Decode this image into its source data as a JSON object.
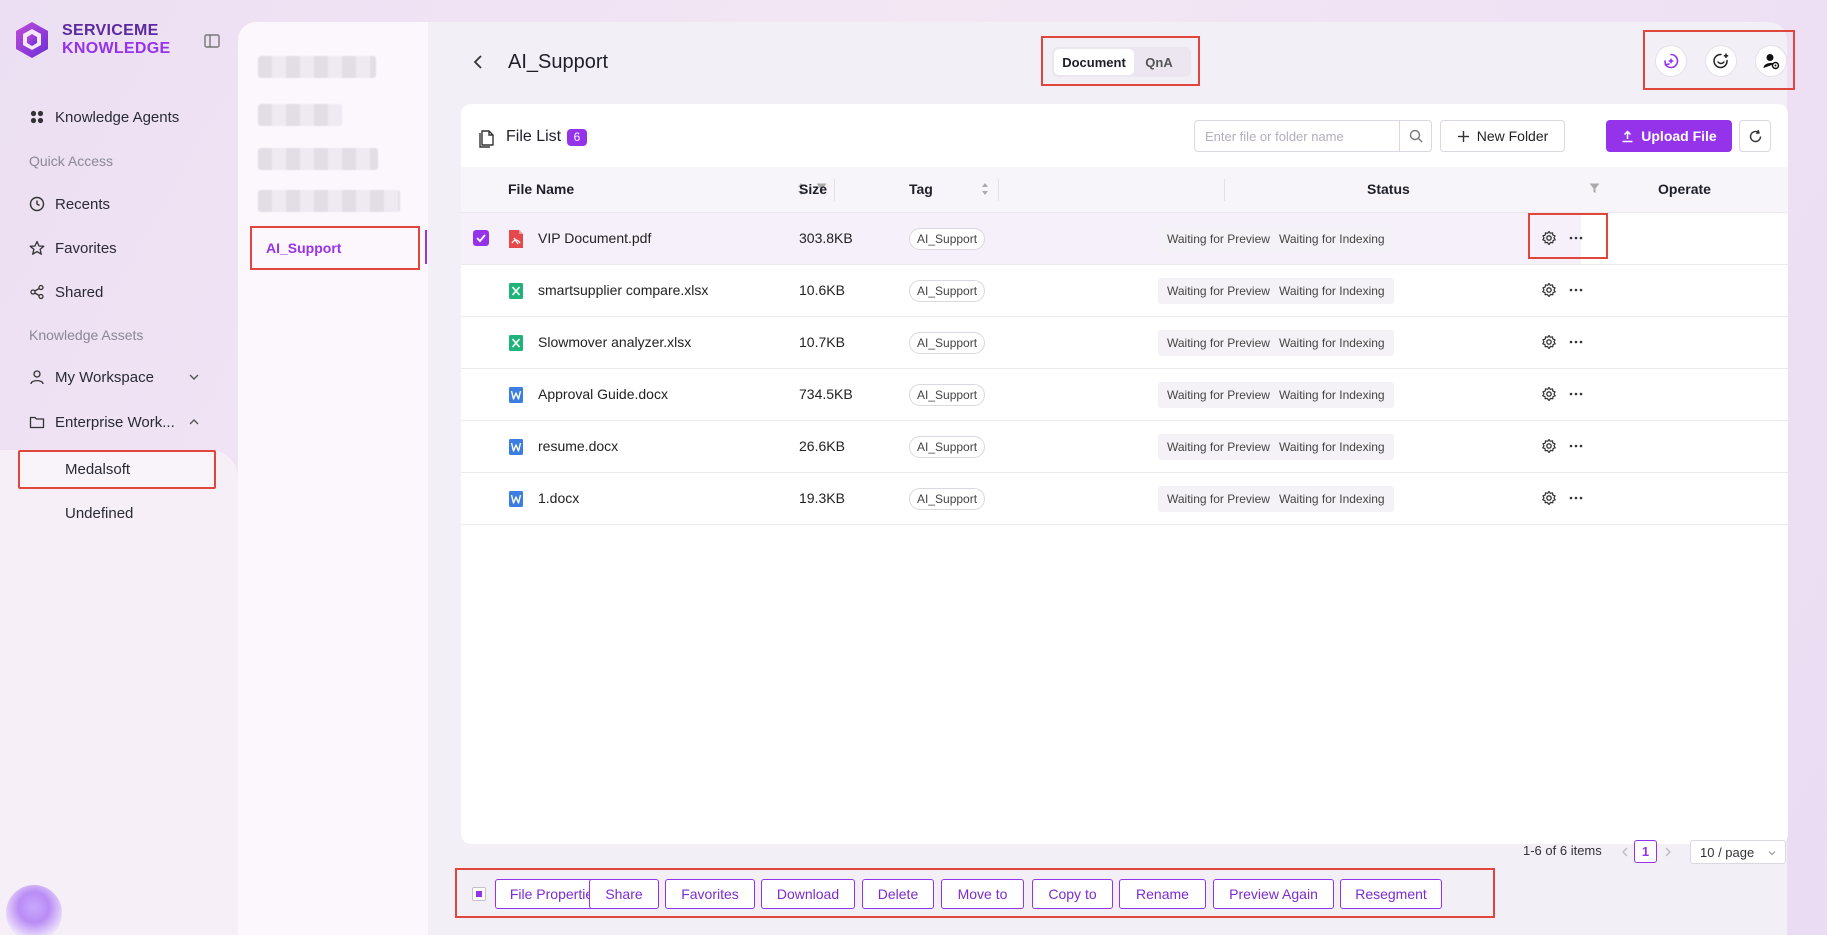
{
  "app": {
    "logo_line1": "SERVICEME",
    "logo_line2": "KNOWLEDGE"
  },
  "nav": {
    "knowledge_agents": "Knowledge Agents",
    "quick_access": "Quick Access",
    "recents": "Recents",
    "favorites": "Favorites",
    "shared": "Shared",
    "knowledge_assets": "Knowledge Assets",
    "my_workspace": "My Workspace",
    "enterprise_workspace": "Enterprise Work...",
    "sub_medalsoft": "Medalsoft",
    "sub_undefined": "Undefined"
  },
  "folders": {
    "active": "AI_Support"
  },
  "header": {
    "title": "AI_Support",
    "tabs": [
      {
        "label": "Document",
        "active": true
      },
      {
        "label": "QnA",
        "active": false
      }
    ],
    "right_buttons": [
      "ai-chat-icon",
      "agent-add-icon",
      "user-settings-icon"
    ]
  },
  "filelist": {
    "title": "File List",
    "count": "6",
    "search_placeholder": "Enter file or folder name",
    "new_folder": "New Folder",
    "upload": "Upload File",
    "columns": {
      "name": "File Name",
      "size": "Size",
      "tag": "Tag",
      "status": "Status",
      "operate": "Operate"
    },
    "rows": [
      {
        "name": "VIP Document.pdf",
        "type": "pdf",
        "size": "303.8KB",
        "tag": "AI_Support",
        "status1": "Waiting for Preview",
        "status2": "Waiting for Indexing",
        "selected": true
      },
      {
        "name": "smartsupplier compare.xlsx",
        "type": "xlsx",
        "size": "10.6KB",
        "tag": "AI_Support",
        "status1": "Waiting for Preview",
        "status2": "Waiting for Indexing",
        "selected": false
      },
      {
        "name": "Slowmover analyzer.xlsx",
        "type": "xlsx",
        "size": "10.7KB",
        "tag": "AI_Support",
        "status1": "Waiting for Preview",
        "status2": "Waiting for Indexing",
        "selected": false
      },
      {
        "name": "Approval Guide.docx",
        "type": "docx",
        "size": "734.5KB",
        "tag": "AI_Support",
        "status1": "Waiting for Preview",
        "status2": "Waiting for Indexing",
        "selected": false
      },
      {
        "name": "resume.docx",
        "type": "docx",
        "size": "26.6KB",
        "tag": "AI_Support",
        "status1": "Waiting for Preview",
        "status2": "Waiting for Indexing",
        "selected": false
      },
      {
        "name": "1.docx",
        "type": "docx",
        "size": "19.3KB",
        "tag": "AI_Support",
        "status1": "Waiting for Preview",
        "status2": "Waiting for Indexing",
        "selected": false
      }
    ]
  },
  "pagination": {
    "info": "1-6 of 6 items",
    "current": "1",
    "page_size": "10 / page"
  },
  "actions": [
    "File Properties",
    "Share",
    "Favorites",
    "Download",
    "Delete",
    "Move to",
    "Copy to",
    "Rename",
    "Preview Again",
    "Resegment"
  ],
  "colors": {
    "accent": "#9433ea",
    "highlight": "#e0463b",
    "pdf": "#e5484d",
    "xlsx": "#1fb37a",
    "docx": "#3b7de0"
  }
}
